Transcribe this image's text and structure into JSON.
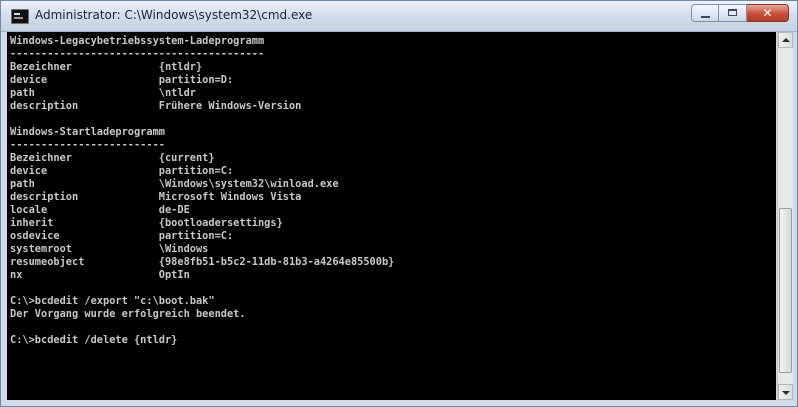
{
  "window": {
    "title": "Administrator: C:\\Windows\\system32\\cmd.exe",
    "icons": {
      "app": "cmd-icon",
      "minimize": "minimize-icon",
      "maximize": "maximize-icon",
      "close": "close-icon"
    },
    "colors": {
      "console_background": "#000000",
      "console_text": "#c8c8c8",
      "close_button": "#c9503b"
    }
  },
  "console": {
    "lines": [
      "Windows-Legacybetriebssystem-Ladeprogramm",
      "-----------------------------------------",
      "Bezeichner              {ntldr}",
      "device                  partition=D:",
      "path                    \\ntldr",
      "description             Frühere Windows-Version",
      "",
      "Windows-Startladeprogramm",
      "-------------------------",
      "Bezeichner              {current}",
      "device                  partition=C:",
      "path                    \\Windows\\system32\\winload.exe",
      "description             Microsoft Windows Vista",
      "locale                  de-DE",
      "inherit                 {bootloadersettings}",
      "osdevice                partition=C:",
      "systemroot              \\Windows",
      "resumeobject            {98e8fb51-b5c2-11db-81b3-a4264e85500b}",
      "nx                      OptIn",
      "",
      "C:\\>bcdedit /export \"c:\\boot.bak\"",
      "Der Vorgang wurde erfolgreich beendet.",
      "",
      "C:\\>bcdedit /delete {ntldr}"
    ]
  },
  "scrollbar": {
    "up_icon": "arrow-up-icon",
    "down_icon": "arrow-down-icon"
  }
}
